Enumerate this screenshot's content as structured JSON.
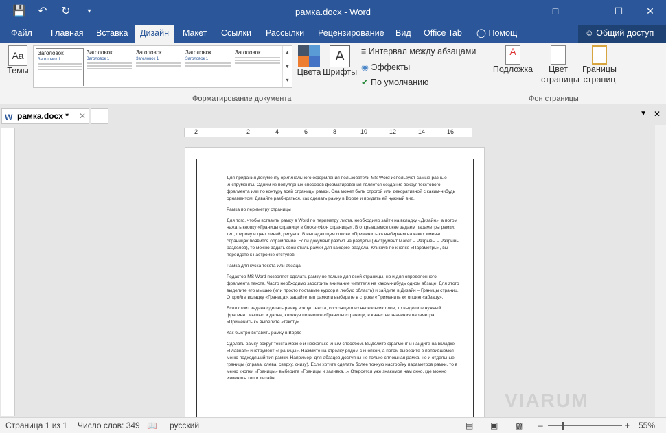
{
  "title": "рамка.docx - Word",
  "tabs": [
    "Файл",
    "Главная",
    "Вставка",
    "Дизайн",
    "Макет",
    "Ссылки",
    "Рассылки",
    "Рецензирование",
    "Вид",
    "Office Tab"
  ],
  "help": "Помощ",
  "share": "Общий доступ",
  "ribbon": {
    "themes": "Темы",
    "colors": "Цвета",
    "fonts": "Шрифты",
    "spacing": "Интервал между абзацами",
    "effects": "Эффекты",
    "default": "По умолчанию",
    "watermark": "Подложка",
    "page_color": "Цвет страницы",
    "page_borders": "Границы страниц",
    "group_format": "Форматирование документа",
    "group_bg": "Фон страницы",
    "style_heading": "Заголовок",
    "style_heading1": "Заголовок 1"
  },
  "doc_tab": "рамка.docx *",
  "ruler_ticks": [
    "2",
    "2",
    "4",
    "6",
    "8",
    "10",
    "12",
    "14",
    "16"
  ],
  "doc": {
    "p1": "Для придания документу оригинального оформления пользователи MS Word используют самые разные инструменты. Одним из популярных способов форматирования является создание вокруг текстового фрагмента или по контуру всей страницы рамки. Она может быть строгой или декоративной с каким-нибудь орнаментом. Давайте разбираться, как сделать рамку в Ворде и придать ей нужный вид.",
    "h1": "Рамка по периметру страницы",
    "p2": "Для того, чтобы вставить рамку в Word по периметру листа, необходимо зайти на вкладку «Дизайн», а потом нажать кнопку «Границы страниц» в блоке «Фон страницы». В открывшемся окне задаем параметры рамки: тип, ширину и цвет линий, рисунок. В выпадающем списке «Применить к» выбираем на каких именно страницах появится обрамление. Если документ разбит на разделы (инструмент Макет – Разрывы – Разрывы разделов), то можно задать свой стиль рамки для каждого раздела. Кликнув по кнопке «Параметры», вы перейдете к настройке отступов.",
    "h2": "Рамка для куска текста или абзаца",
    "p3": "Редактор MS Word позволяет сделать рамку не только для всей страницы, но и для определенного фрагмента текста. Часто необходимо заострить внимание читателя на каком-нибудь одном абзаце. Для этого выделите его мышью (или просто поставьте курсор в любую область) и зайдите в Дизайн – Границы страниц. Откройте вкладку «Граница», задайте тип рамки и выберите в строке «Применить к» опцию «абзацу».",
    "p4": "Если стоит задача сделать рамку вокруг текста, состоящего из нескольких слов, то выделите нужный фрагмент мышью и далее, кликнув по кнопке «Границы страниц», в качестве значения параметра «Применить к» выберите «тексту».",
    "h3": "Как быстро вставить рамку в Ворде",
    "p5": "Сделать рамку вокруг текста можно и несколько иным способом. Выделите фрагмент и найдите на вкладке «Главная» инструмент «Границы». Нажмите на стрелку рядом с кнопкой, а потом выберите в появившемся меню подходящий тип рамки. Например, для абзацев доступны не только сплошная рамка, но и отдельные границы (справа, слева, сверху, снизу). Если хотите сделать более тонкую настройку параметров рамки, то в меню кнопки «Границы» выберите «Границы и заливка...» Откроется уже знакомое нам окно, где можно изменить тип и дизайн"
  },
  "status": {
    "page": "Страница 1 из 1",
    "words": "Число слов: 349",
    "lang": "русский",
    "zoom": "55%"
  },
  "watermark_text": "VIARUM"
}
